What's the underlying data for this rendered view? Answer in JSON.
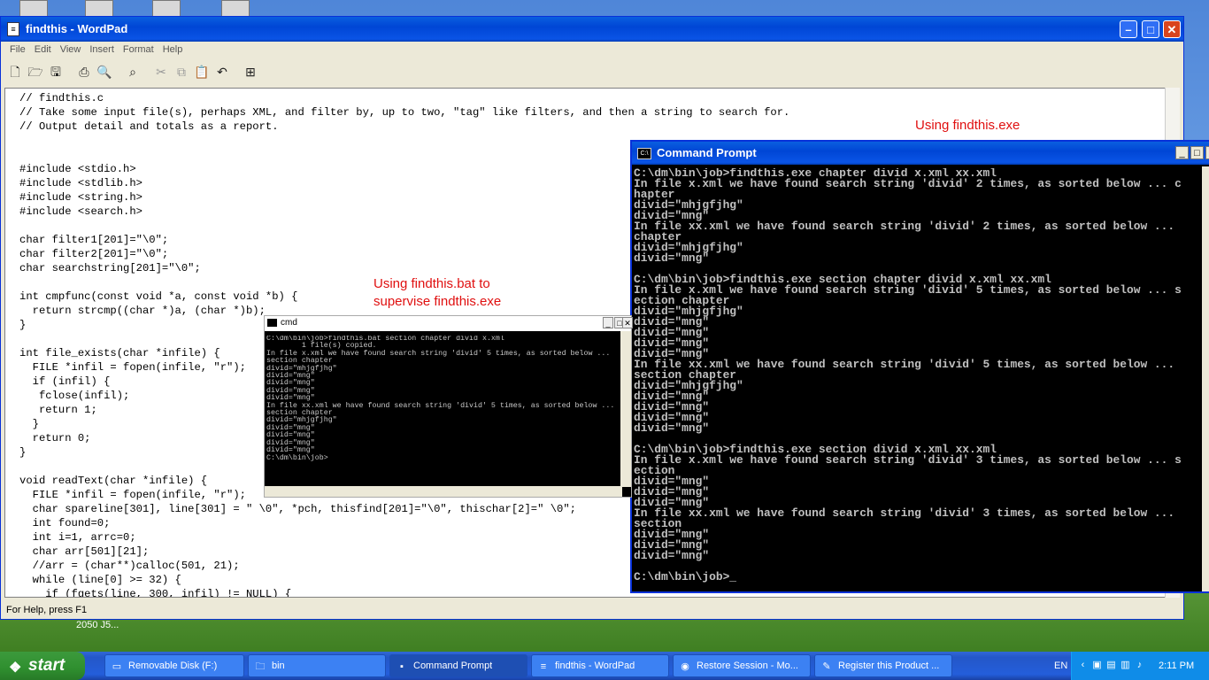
{
  "desktop": {
    "icon_label": "2050 J5..."
  },
  "wordpad": {
    "title": "findthis - WordPad",
    "menu": [
      "File",
      "Edit",
      "View",
      "Insert",
      "Format",
      "Help"
    ],
    "status": "For Help, press F1",
    "code": "// findthis.c\n// Take some input file(s), perhaps XML, and filter by, up to two, \"tag\" like filters, and then a string to search for.\n// Output detail and totals as a report.\n\n\n#include <stdio.h>\n#include <stdlib.h>\n#include <string.h>\n#include <search.h>\n\nchar filter1[201]=\"\\0\";\nchar filter2[201]=\"\\0\";\nchar searchstring[201]=\"\\0\";\n\nint cmpfunc(const void *a, const void *b) {\n  return strcmp((char *)a, (char *)b);\n}\n\nint file_exists(char *infile) {\n  FILE *infil = fopen(infile, \"r\");\n  if (infil) {\n   fclose(infil);\n   return 1;\n  }\n  return 0;\n}\n\nvoid readText(char *infile) {\n  FILE *infil = fopen(infile, \"r\");\n  char spareline[301], line[301] = \" \\0\", *pch, thisfind[201]=\"\\0\", thischar[2]=\" \\0\";\n  int found=0;\n  int i=1, arrc=0;\n  char arr[501][21];\n  //arr = (char**)calloc(501, 21);\n  while (line[0] >= 32) {\n    if (fgets(line, 300, infil) != NULL) {"
  },
  "annotations": {
    "exe_note": "Using findthis.exe",
    "bat_note_1": "Using findthis.bat to",
    "bat_note_2": "supervise findthis.exe"
  },
  "command_prompt": {
    "title": "Command Prompt",
    "output": "C:\\dm\\bin\\job>findthis.exe chapter divid x.xml xx.xml\nIn file x.xml we have found search string 'divid' 2 times, as sorted below ... c\nhapter\ndivid=\"mhjgfjhg\"\ndivid=\"mng\"\nIn file xx.xml we have found search string 'divid' 2 times, as sorted below ...\nchapter\ndivid=\"mhjgfjhg\"\ndivid=\"mng\"\n\nC:\\dm\\bin\\job>findthis.exe section chapter divid x.xml xx.xml\nIn file x.xml we have found search string 'divid' 5 times, as sorted below ... s\nection chapter\ndivid=\"mhjgfjhg\"\ndivid=\"mng\"\ndivid=\"mng\"\ndivid=\"mng\"\ndivid=\"mng\"\nIn file xx.xml we have found search string 'divid' 5 times, as sorted below ...\nsection chapter\ndivid=\"mhjgfjhg\"\ndivid=\"mng\"\ndivid=\"mng\"\ndivid=\"mng\"\ndivid=\"mng\"\n\nC:\\dm\\bin\\job>findthis.exe section divid x.xml xx.xml\nIn file x.xml we have found search string 'divid' 3 times, as sorted below ... s\nection\ndivid=\"mng\"\ndivid=\"mng\"\ndivid=\"mng\"\nIn file xx.xml we have found search string 'divid' 3 times, as sorted below ...\nsection\ndivid=\"mng\"\ndivid=\"mng\"\ndivid=\"mng\"\n\nC:\\dm\\bin\\job>_"
  },
  "cmd_small": {
    "title": "cmd",
    "output": "C:\\dm\\bin\\job>findthis.bat section chapter divid x.xml\n        1 file(s) copied.\nIn file x.xml we have found search string 'divid' 5 times, as sorted below ...\nsection chapter\ndivid=\"mhjgfjhg\"\ndivid=\"mng\"\ndivid=\"mng\"\ndivid=\"mng\"\ndivid=\"mng\"\nIn file xx.xml we have found search string 'divid' 5 times, as sorted below ...\nsection chapter\ndivid=\"mhjgfjhg\"\ndivid=\"mng\"\ndivid=\"mng\"\ndivid=\"mng\"\ndivid=\"mng\"\nC:\\dm\\bin\\job>"
  },
  "taskbar": {
    "start_label": "start",
    "tasks": [
      {
        "label": "Removable Disk (F:)",
        "icon": "drive-icon"
      },
      {
        "label": "bin",
        "icon": "folder-icon"
      },
      {
        "label": "Command Prompt",
        "icon": "console-icon"
      },
      {
        "label": "findthis - WordPad",
        "icon": "wordpad-icon"
      },
      {
        "label": "Restore Session - Mo...",
        "icon": "firefox-icon"
      },
      {
        "label": "Register this Product ...",
        "icon": "register-icon"
      }
    ],
    "language": "EN",
    "clock": "2:11 PM"
  }
}
